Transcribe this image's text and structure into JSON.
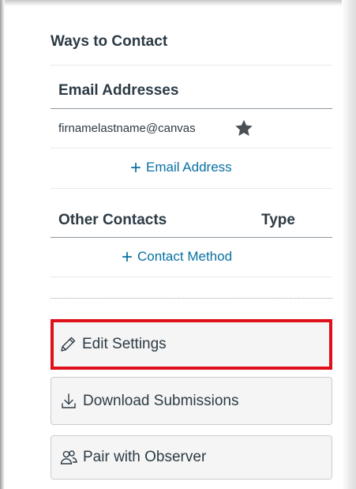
{
  "ways_to_contact": {
    "title": "Ways to Contact"
  },
  "email_section": {
    "header": "Email Addresses",
    "email": "firnamelastname@canvas",
    "default_icon": "star-icon",
    "add_label": "Email Address"
  },
  "other_contacts": {
    "header": "Other Contacts",
    "type_header": "Type",
    "add_label": "Contact Method"
  },
  "actions": {
    "edit_settings": {
      "label": "Edit Settings",
      "icon": "pencil-icon"
    },
    "download_submissions": {
      "label": "Download Submissions",
      "icon": "download-icon"
    },
    "pair_with_observer": {
      "label": "Pair with Observer",
      "icon": "users-icon"
    }
  },
  "colors": {
    "link": "#0770a3",
    "text": "#2d3b45",
    "highlight": "#e0101a",
    "button_bg": "#f5f5f5"
  }
}
